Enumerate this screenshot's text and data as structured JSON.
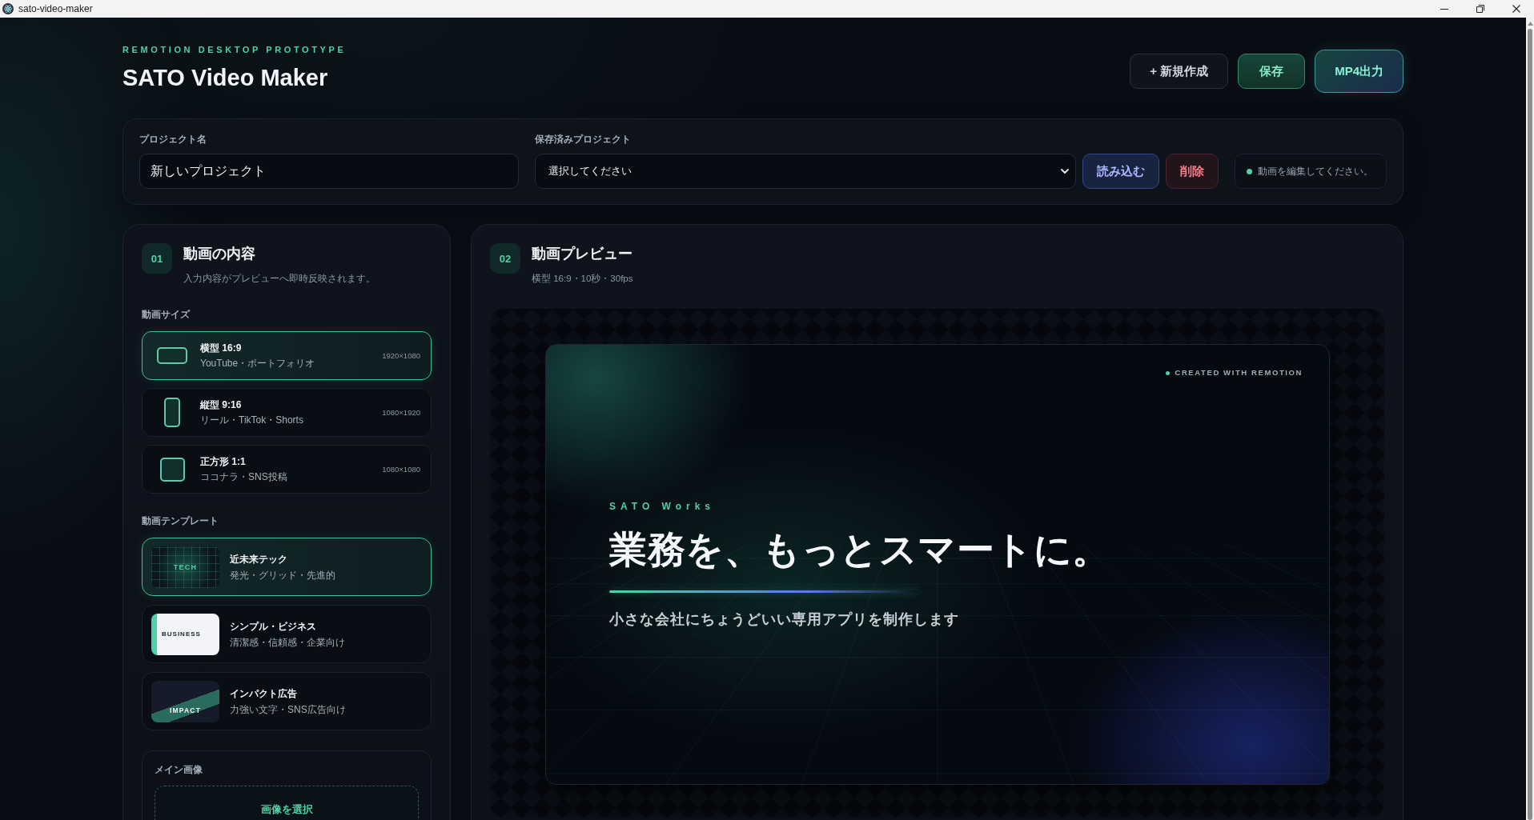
{
  "window": {
    "title": "sato-video-maker"
  },
  "header": {
    "eyebrow": "REMOTION DESKTOP PROTOTYPE",
    "title": "SATO Video Maker",
    "actions": [
      {
        "label": "+ 新規作成",
        "kind": "new"
      },
      {
        "label": "保存",
        "kind": "save"
      },
      {
        "label": "MP4出力",
        "kind": "export"
      }
    ]
  },
  "project_bar": {
    "name_field": {
      "label": "プロジェクト名",
      "value": "新しいプロジェクト"
    },
    "saved_projects": {
      "label": "保存済みプロジェクト",
      "value": "選択してください"
    },
    "buttons": [
      {
        "label": "読み込む",
        "kind": "load"
      },
      {
        "label": "削除",
        "kind": "delete"
      }
    ],
    "status": "動画を編集してください。"
  },
  "content_panel": {
    "step": "01",
    "title": "動画の内容",
    "subtitle": "入力内容がプレビューへ即時反映されます。",
    "size_section": {
      "label": "動画サイズ",
      "options": [
        {
          "title": "横型 16:9",
          "subtitle": "YouTube・ポートフォリオ",
          "resolution": "1920×1080",
          "kind": "landscape",
          "selected": true
        },
        {
          "title": "縦型 9:16",
          "subtitle": "リール・TikTok・Shorts",
          "resolution": "1080×1920",
          "kind": "portrait",
          "selected": false
        },
        {
          "title": "正方形 1:1",
          "subtitle": "ココナラ・SNS投稿",
          "resolution": "1080×1080",
          "kind": "square",
          "selected": false
        }
      ]
    },
    "template_section": {
      "label": "動画テンプレート",
      "options": [
        {
          "title": "近未来テック",
          "subtitle": "発光・グリッド・先進的",
          "thumbnail": "TECH",
          "kind": "tech",
          "selected": true
        },
        {
          "title": "シンプル・ビジネス",
          "subtitle": "清潔感・信頼感・企業向け",
          "thumbnail": "BUSINESS",
          "kind": "business",
          "selected": false
        },
        {
          "title": "インパクト広告",
          "subtitle": "力強い文字・SNS広告向け",
          "thumbnail": "IMPACT",
          "kind": "impact",
          "selected": false
        }
      ]
    },
    "main_image": {
      "label": "メイン画像",
      "button": "画像を選択"
    }
  },
  "preview_panel": {
    "step": "02",
    "title": "動画プレビュー",
    "subtitle": "横型 16:9・10秒・30fps",
    "video": {
      "badge": "CREATED WITH REMOTION",
      "eyebrow": "SATO Works",
      "headline": "業務を、もっとスマートに。",
      "tagline": "小さな会社にちょうどいい専用アプリを制作します"
    }
  }
}
